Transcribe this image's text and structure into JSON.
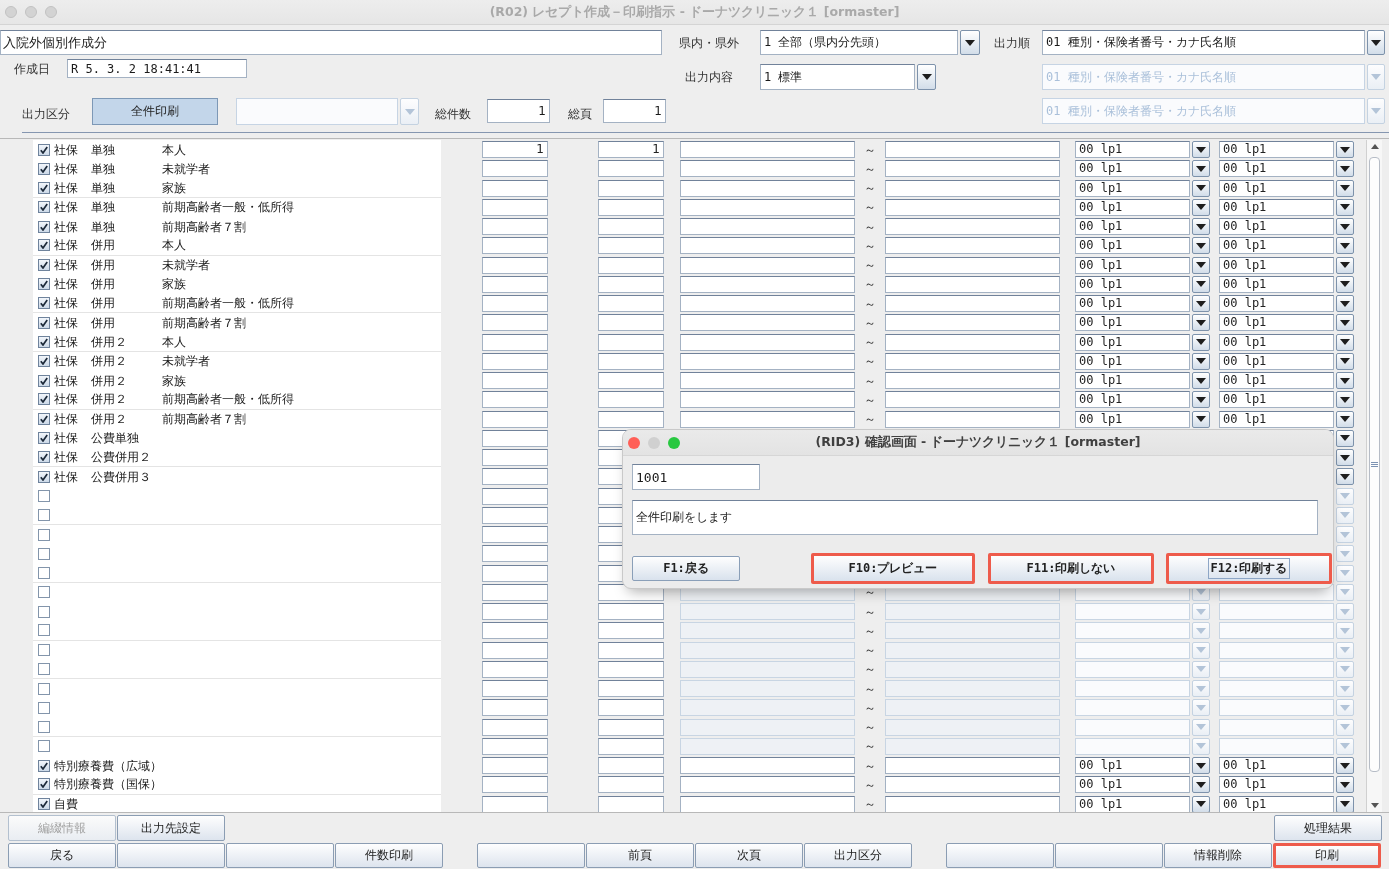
{
  "window": {
    "title": "(R02) レセプト作成－印刷指示 - ドーナツクリニック１ [ormaster]",
    "active": false
  },
  "header": {
    "title_field": "入院外個別作成分",
    "region": {
      "label": "県内・県外",
      "value": "1 全部（県内分先頭）",
      "disabled": false
    },
    "sort_order": {
      "label": "出力順",
      "value": "01 種別・保険者番号・カナ氏名順",
      "disabled": false
    },
    "created": {
      "label": "作成日",
      "value": "R 5. 3. 2 18:41:41"
    },
    "content": {
      "label": "出力内容",
      "value": "1 標準",
      "disabled": false
    },
    "sort_order_2": {
      "value": "01 種別・保険者番号・カナ氏名順",
      "disabled": true
    },
    "output_type": {
      "label": "出力区分",
      "button": {
        "label": "全件印刷",
        "selected": true
      },
      "combo": {
        "disabled": true
      }
    },
    "total_count": {
      "label": "総件数",
      "value": "1"
    },
    "total_pages": {
      "label": "総頁",
      "value": "1"
    },
    "sort_order_3": {
      "value": "01 種別・保険者番号・カナ氏名順",
      "disabled": true
    }
  },
  "table": {
    "groups": [
      {
        "rows": [
          {
            "checked": true,
            "labels": [
              "社保",
              "単独",
              "本人"
            ],
            "value_1": "1",
            "value_2": "1",
            "separator": "～",
            "printer_1": "00 lp1",
            "printer_2": "00 lp1",
            "disabled": false
          },
          {
            "checked": true,
            "labels": [
              "社保",
              "単独",
              "未就学者"
            ],
            "separator": "～",
            "printer_1": "00 lp1",
            "printer_2": "00 lp1",
            "disabled": false
          },
          {
            "checked": true,
            "labels": [
              "社保",
              "単独",
              "家族"
            ],
            "separator": "～",
            "printer_1": "00 lp1",
            "printer_2": "00 lp1",
            "disabled": false
          }
        ]
      },
      {
        "rows": [
          {
            "checked": true,
            "labels": [
              "社保",
              "単独",
              "前期高齢者一般・低所得"
            ],
            "separator": "～",
            "printer_1": "00 lp1",
            "printer_2": "00 lp1",
            "disabled": false
          },
          {
            "checked": true,
            "labels": [
              "社保",
              "単独",
              "前期高齢者７割"
            ],
            "separator": "～",
            "printer_1": "00 lp1",
            "printer_2": "00 lp1",
            "disabled": false
          },
          {
            "checked": true,
            "labels": [
              "社保",
              "併用",
              "本人"
            ],
            "separator": "～",
            "printer_1": "00 lp1",
            "printer_2": "00 lp1",
            "disabled": false
          }
        ]
      },
      {
        "rows": [
          {
            "checked": true,
            "labels": [
              "社保",
              "併用",
              "未就学者"
            ],
            "separator": "～",
            "printer_1": "00 lp1",
            "printer_2": "00 lp1",
            "disabled": false
          },
          {
            "checked": true,
            "labels": [
              "社保",
              "併用",
              "家族"
            ],
            "separator": "～",
            "printer_1": "00 lp1",
            "printer_2": "00 lp1",
            "disabled": false
          },
          {
            "checked": true,
            "labels": [
              "社保",
              "併用",
              "前期高齢者一般・低所得"
            ],
            "separator": "～",
            "printer_1": "00 lp1",
            "printer_2": "00 lp1",
            "disabled": false
          }
        ]
      },
      {
        "rows": [
          {
            "checked": true,
            "labels": [
              "社保",
              "併用",
              "前期高齢者７割"
            ],
            "separator": "～",
            "printer_1": "00 lp1",
            "printer_2": "00 lp1",
            "disabled": false
          },
          {
            "checked": true,
            "labels": [
              "社保",
              "併用２",
              "本人"
            ],
            "separator": "～",
            "printer_1": "00 lp1",
            "printer_2": "00 lp1",
            "disabled": false
          }
        ]
      },
      {
        "rows": [
          {
            "checked": true,
            "labels": [
              "社保",
              "併用２",
              "未就学者"
            ],
            "separator": "～",
            "printer_1": "00 lp1",
            "printer_2": "00 lp1",
            "disabled": false
          },
          {
            "checked": true,
            "labels": [
              "社保",
              "併用２",
              "家族"
            ],
            "separator": "～",
            "printer_1": "00 lp1",
            "printer_2": "00 lp1",
            "disabled": false
          },
          {
            "checked": true,
            "labels": [
              "社保",
              "併用２",
              "前期高齢者一般・低所得"
            ],
            "separator": "～",
            "printer_1": "00 lp1",
            "printer_2": "00 lp1",
            "disabled": false
          }
        ]
      },
      {
        "rows": [
          {
            "checked": true,
            "labels": [
              "社保",
              "併用２",
              "前期高齢者７割"
            ],
            "separator": "～",
            "printer_1": "00 lp1",
            "printer_2": "00 lp1",
            "disabled": false
          },
          {
            "checked": true,
            "labels": [
              "社保",
              "公費単独"
            ],
            "disabled": false
          },
          {
            "checked": true,
            "labels": [
              "社保",
              "公費併用２"
            ],
            "disabled": false
          }
        ]
      },
      {
        "rows": [
          {
            "checked": true,
            "labels": [
              "社保",
              "公費併用３"
            ],
            "disabled": false
          },
          {
            "checked": false,
            "disabled": true
          },
          {
            "checked": false,
            "disabled": true
          }
        ]
      },
      {
        "rows": [
          {
            "checked": false,
            "disabled": true
          },
          {
            "checked": false,
            "disabled": true
          },
          {
            "checked": false,
            "disabled": true
          }
        ]
      },
      {
        "rows": [
          {
            "checked": false,
            "separator": "～",
            "disabled": true
          },
          {
            "checked": false,
            "separator": "～",
            "disabled": true
          },
          {
            "checked": false,
            "separator": "～",
            "disabled": true
          }
        ]
      },
      {
        "rows": [
          {
            "checked": false,
            "separator": "～",
            "disabled": true
          },
          {
            "checked": false,
            "separator": "～",
            "disabled": true
          }
        ]
      },
      {
        "rows": [
          {
            "checked": false,
            "separator": "～",
            "disabled": true
          },
          {
            "checked": false,
            "separator": "～",
            "disabled": true
          },
          {
            "checked": false,
            "separator": "～",
            "disabled": true
          }
        ]
      },
      {
        "rows": [
          {
            "checked": false,
            "separator": "～",
            "disabled": true
          },
          {
            "checked": true,
            "labels": [
              "特別療養費（広域）"
            ],
            "separator": "～",
            "printer_1": "00 lp1",
            "printer_2": "00 lp1",
            "disabled": false
          },
          {
            "checked": true,
            "labels": [
              "特別療養費（国保）"
            ],
            "separator": "～",
            "printer_1": "00 lp1",
            "printer_2": "00 lp1",
            "disabled": false
          }
        ]
      },
      {
        "rows": [
          {
            "checked": true,
            "labels": [
              "自費"
            ],
            "separator": "～",
            "printer_1": "00 lp1",
            "printer_2": "00 lp1",
            "disabled": false
          }
        ]
      }
    ]
  },
  "dialog": {
    "title": "(RID3) 確認画面 - ドーナツクリニック１ [ormaster]",
    "active": true,
    "window_buttons": [
      {
        "color": "#ff5f57"
      },
      {
        "color": "#d0d0d0"
      },
      {
        "color": "#28c840"
      }
    ],
    "code": "1001",
    "message": "全件印刷をします",
    "buttons": [
      {
        "label": "F1:戻る",
        "highlighted": false,
        "focused": false
      },
      {
        "label": "F10:プレビュー",
        "highlighted": true,
        "focused": false
      },
      {
        "label": "F11:印刷しない",
        "highlighted": true,
        "focused": false
      },
      {
        "label": "F12:印刷する",
        "highlighted": true,
        "focused": true
      }
    ]
  },
  "bottom_bar": {
    "upper_left": [
      {
        "label": "編綴情報",
        "disabled": true,
        "highlighted": false
      },
      {
        "label": "出力先設定",
        "disabled": false,
        "highlighted": false
      }
    ],
    "upper_right": [
      {
        "label": "処理結果",
        "disabled": false,
        "highlighted": false
      }
    ],
    "lower_groups": [
      {
        "buttons": [
          {
            "label": "戻る",
            "disabled": false,
            "highlighted": false
          },
          {
            "disabled": false,
            "highlighted": false
          },
          {
            "disabled": false,
            "highlighted": false
          },
          {
            "label": "件数印刷",
            "disabled": false,
            "highlighted": false
          }
        ]
      },
      {
        "buttons": [
          {
            "disabled": false,
            "highlighted": false
          },
          {
            "label": "前頁",
            "disabled": false,
            "highlighted": false
          },
          {
            "label": "次頁",
            "disabled": false,
            "highlighted": false
          },
          {
            "label": "出力区分",
            "disabled": false,
            "highlighted": false
          }
        ]
      },
      {
        "buttons": [
          {
            "disabled": false,
            "highlighted": false
          },
          {
            "disabled": false,
            "highlighted": false
          },
          {
            "label": "情報削除",
            "disabled": false,
            "highlighted": false
          },
          {
            "label": "印刷",
            "disabled": false,
            "highlighted": true
          }
        ]
      }
    ]
  }
}
